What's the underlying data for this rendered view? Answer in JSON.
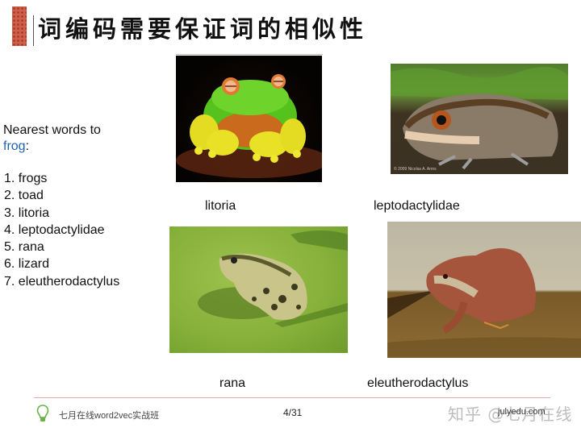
{
  "slide": {
    "title": "词编码需要保证词的相似性",
    "intro_prefix": "Nearest words to",
    "intro_keyword": "frog",
    "intro_suffix": ":",
    "nearest_words": [
      "1. frogs",
      "2. toad",
      "3. litoria",
      "4. leptodactylidae",
      "5. rana",
      "6. lizard",
      "7. eleutherodactylus"
    ],
    "photos": [
      {
        "caption": "litoria",
        "subject": "green tree frog with orange eyes on dark background"
      },
      {
        "caption": "leptodactylidae",
        "subject": "brown ground frog on leaf litter",
        "credit": "© 2009 Nicolas A. Arms"
      },
      {
        "caption": "rana",
        "subject": "spotted green frog on lily pad"
      },
      {
        "caption": "eleutherodactylus",
        "subject": "reddish-brown frog on dry leaf"
      }
    ]
  },
  "footer": {
    "course": "七月在线word2vec实战班",
    "page": "4/31",
    "url": "julyedu.com",
    "watermark": "知乎 @七月在线",
    "icon": "lightbulb-icon"
  },
  "colors": {
    "keyword": "#2062b0",
    "title_mark": "#cf5f49",
    "footer_rule": "#e6a9a5",
    "bulb": "#6ab04c"
  }
}
